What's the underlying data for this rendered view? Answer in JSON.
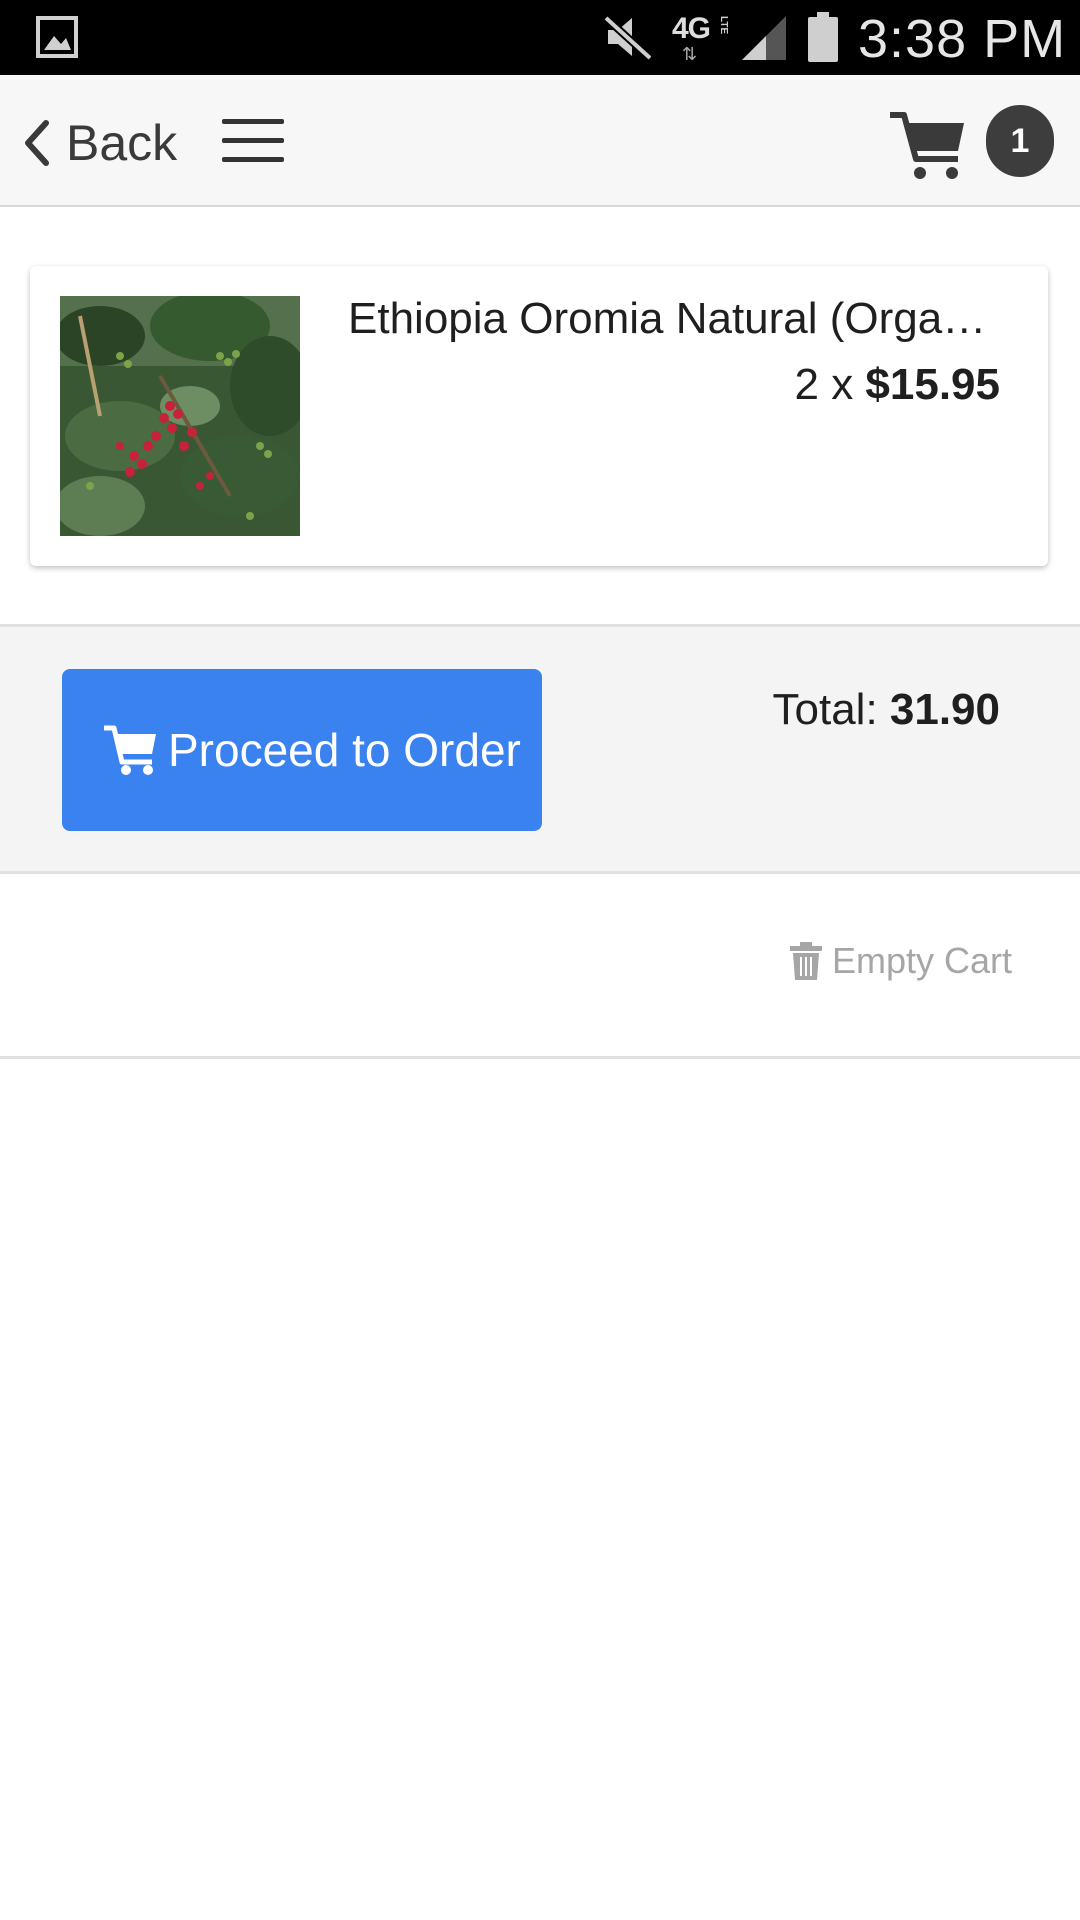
{
  "status_bar": {
    "time": "3:38 PM",
    "network": "4G",
    "network_sub": "LTE",
    "icons": [
      "gallery-icon",
      "mute-icon",
      "signal-icon",
      "battery-icon"
    ]
  },
  "header": {
    "back_label": "Back",
    "cart_count": "1",
    "icons": [
      "chevron-left-icon",
      "hamburger-menu-icon",
      "cart-icon"
    ]
  },
  "cart": {
    "items": [
      {
        "name": "Ethiopia Oromia Natural (Orga…",
        "quantity_prefix": "2 x ",
        "price": "$15.95"
      }
    ],
    "total_label": "Total: ",
    "total_value": "31.90",
    "proceed_label": "Proceed to Order",
    "empty_label": "Empty Cart"
  },
  "colors": {
    "primary_button": "#3b82f1",
    "badge": "#3d3d3d",
    "muted_text": "#a6a6a6"
  }
}
